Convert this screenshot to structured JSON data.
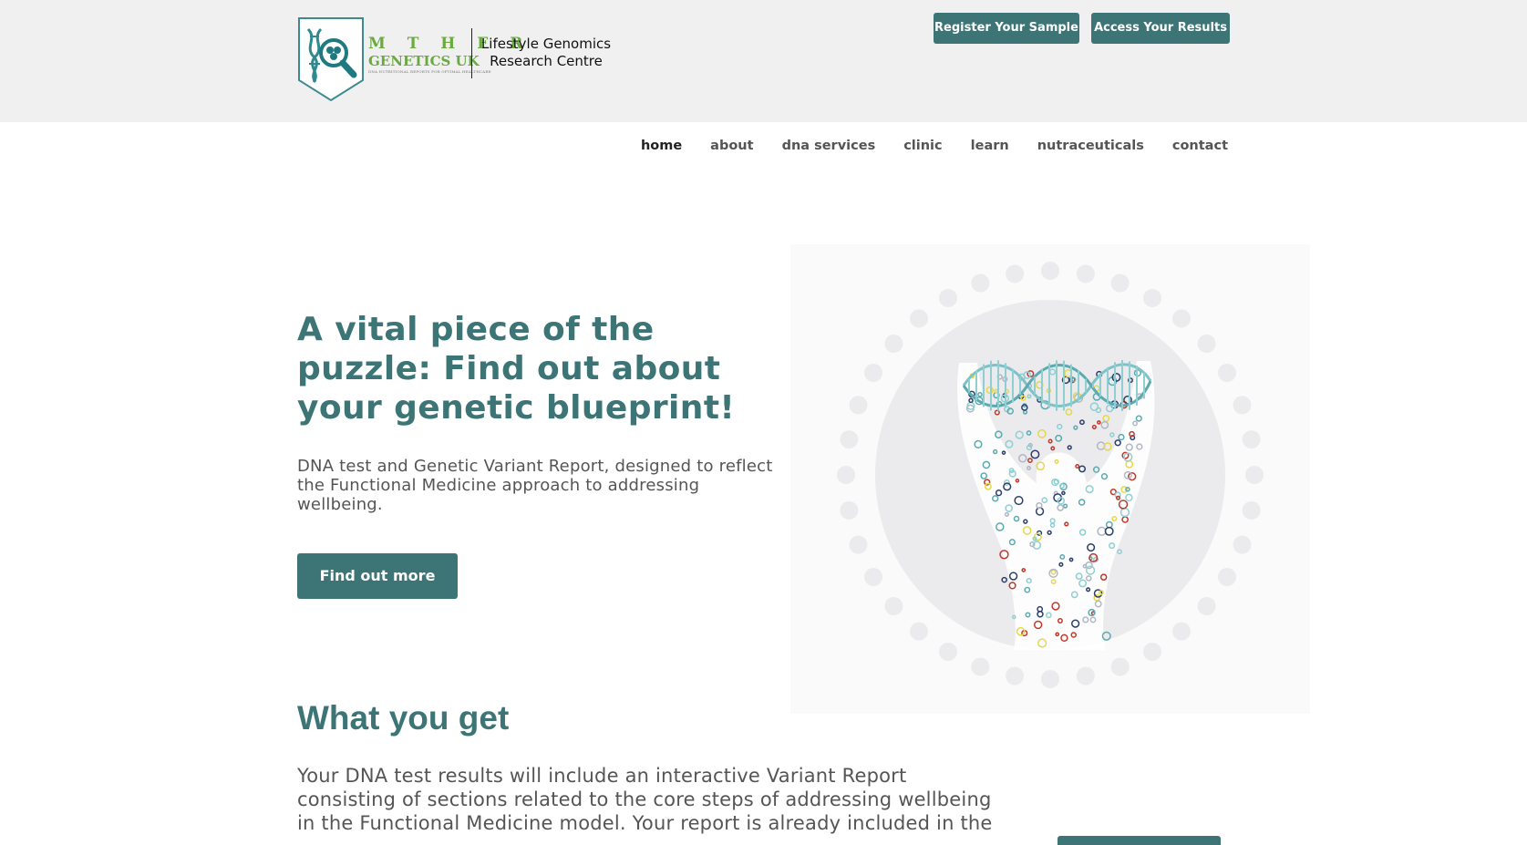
{
  "header": {
    "logo": {
      "brand_line1": "M T H F R",
      "brand_line2": "GENETICS UK",
      "tagline": "DNA NUTRITIONAL REPORTS FOR OPTIMAL HEALTHCARE",
      "right_line1": "Lifestyle Genomics",
      "right_line2": "Research Centre"
    },
    "register_label": "Register Your Sample",
    "access_label": "Access Your Results"
  },
  "nav": {
    "items": [
      {
        "label": "home",
        "active": true
      },
      {
        "label": "about"
      },
      {
        "label": "dna services"
      },
      {
        "label": "clinic"
      },
      {
        "label": "learn"
      },
      {
        "label": "nutraceuticals"
      },
      {
        "label": "contact"
      }
    ]
  },
  "hero": {
    "title": "A vital piece of the puzzle: Find out about your genetic blueprint!",
    "subtitle": "DNA test and Genetic Variant Report, designed to reflect the Functional Medicine approach to addressing wellbeing.",
    "cta_label": "Find out more"
  },
  "what_you_get": {
    "title": "What you get",
    "body": "Your DNA test results will include an interactive Variant Report consisting of sections related to the core steps of addressing wellbeing in the Functional Medicine model. Your report is already included in the"
  },
  "colors": {
    "accent": "#3d7577",
    "logo_green": "#6aaa3f",
    "topbar_bg": "#f0f0f0",
    "text": "#555555"
  },
  "icons": {
    "logo": "dna-magnifier-shield-icon",
    "illustration": "dna-human-figure-illustration"
  }
}
